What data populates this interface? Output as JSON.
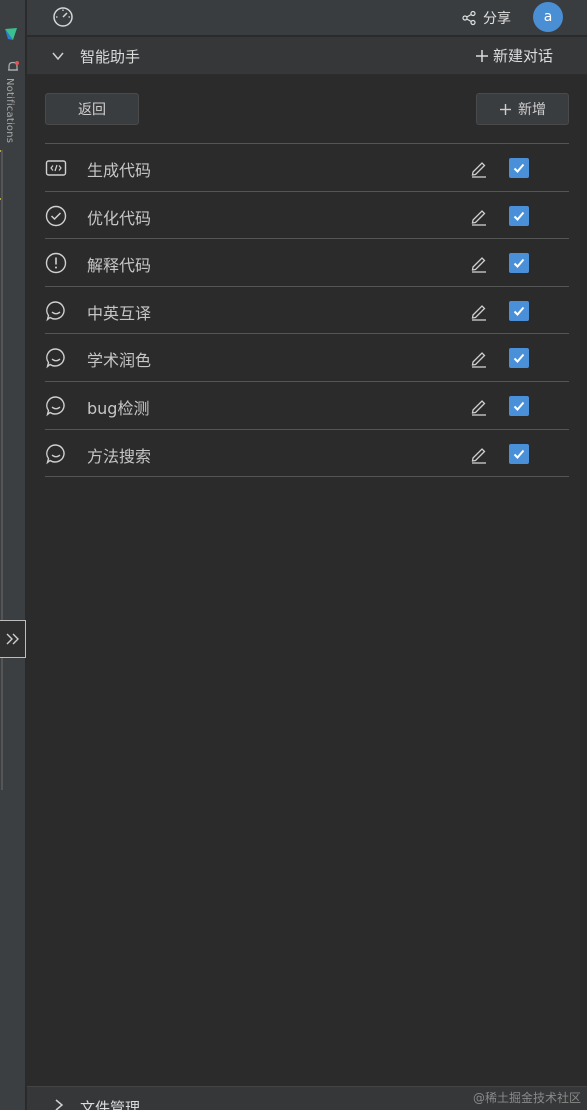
{
  "sidebar": {
    "notifications_label": "Notifications"
  },
  "topbar": {
    "share_label": "分享",
    "avatar_letter": "a"
  },
  "section": {
    "title": "智能助手",
    "new_chat_label": "新建对话"
  },
  "actions": {
    "back_label": "返回",
    "add_label": "新增"
  },
  "items": [
    {
      "label": "生成代码",
      "icon": "code-icon",
      "checked": true
    },
    {
      "label": "优化代码",
      "icon": "check-circle-icon",
      "checked": true
    },
    {
      "label": "解释代码",
      "icon": "info-circle-icon",
      "checked": true
    },
    {
      "label": "中英互译",
      "icon": "chat-bubble-icon",
      "checked": true
    },
    {
      "label": "学术润色",
      "icon": "chat-bubble-icon",
      "checked": true
    },
    {
      "label": "bug检测",
      "icon": "chat-bubble-icon",
      "checked": true
    },
    {
      "label": "方法搜索",
      "icon": "chat-bubble-icon",
      "checked": true
    }
  ],
  "bottom": {
    "title": "文件管理"
  },
  "watermark": "@稀土掘金技术社区",
  "colors": {
    "accent": "#4a90d9",
    "background": "#2b2b2b"
  }
}
